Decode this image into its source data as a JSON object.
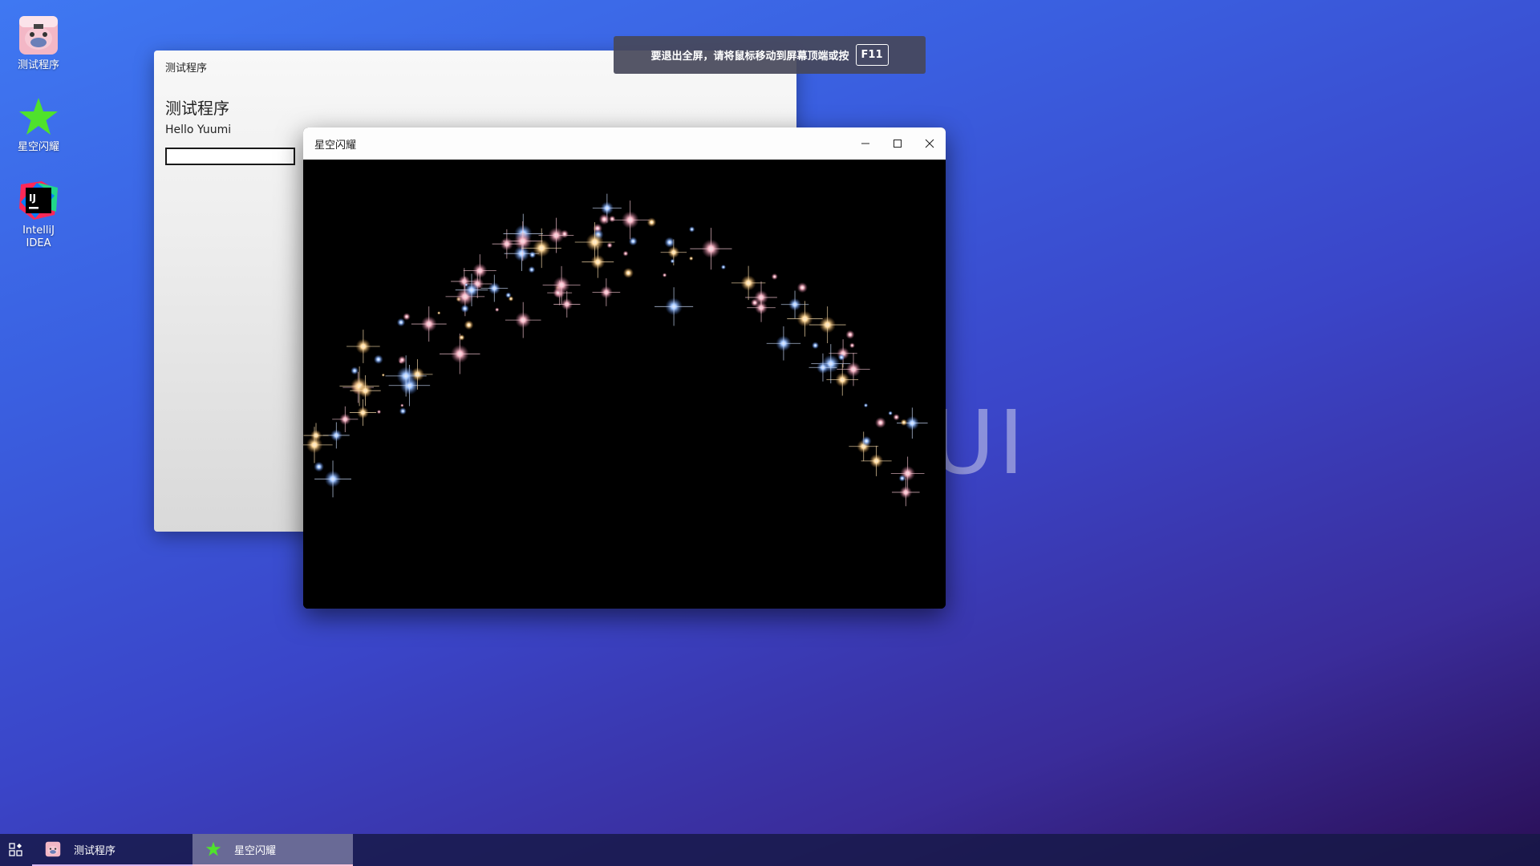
{
  "desktop": {
    "icons": [
      {
        "label": "测试程序",
        "icon": "pig-app-icon"
      },
      {
        "label": "星空闪耀",
        "icon": "green-star-icon"
      },
      {
        "label": "IntelliJ\nIDEA",
        "icon": "intellij-idea-icon"
      }
    ],
    "watermark": "UI"
  },
  "toast": {
    "text": "要退出全屏，请将鼠标移动到屏幕顶端或按",
    "key": "F11"
  },
  "back_window": {
    "title": "测试程序",
    "heading": "测试程序",
    "hello": "Hello Yuumi",
    "input_value": ""
  },
  "front_window": {
    "title": "星空闪耀",
    "content": "starfield-canvas"
  },
  "taskbar": {
    "start_icon": "apps-grid-icon",
    "items": [
      {
        "label": "测试程序",
        "icon": "pig-app-icon",
        "active": false
      },
      {
        "label": "星空闪耀",
        "icon": "green-star-icon",
        "active": true
      }
    ]
  },
  "colors": {
    "accent_star": "#4fe22c",
    "toast_bg": "#46485a",
    "taskbar_bg": "#16184a"
  }
}
